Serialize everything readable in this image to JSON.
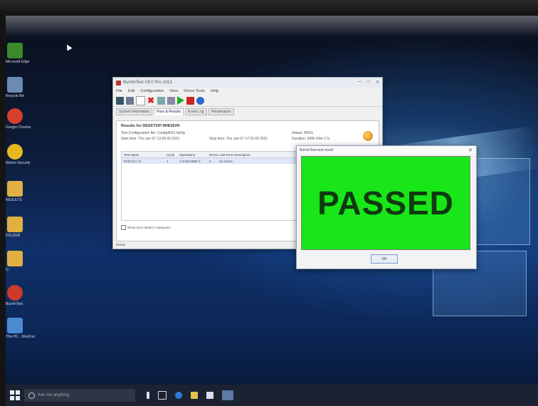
{
  "desktop": {
    "icons": [
      {
        "label": "Microsoft Edge",
        "color": "#3a8a2a"
      },
      {
        "label": "Recycle Bin",
        "color": "#6b8bb0"
      },
      {
        "label": "Google Chrome",
        "color": "#d8402a"
      },
      {
        "label": "Norton Security",
        "color": "#e8b820"
      },
      {
        "label": "RESULTS",
        "color": "#e0b040"
      },
      {
        "label": "FOLDER",
        "color": "#e0b040"
      },
      {
        "label": "C:",
        "color": "#e0b040"
      },
      {
        "label": "BurnInTest",
        "color": "#cc3a2a"
      },
      {
        "label": "This PC - Shortcut",
        "color": "#4a8ad0"
      }
    ]
  },
  "main_window": {
    "title": "BurnInTest V9.0 Pro 1013",
    "menu": [
      "File",
      "Edit",
      "Configuration",
      "View",
      "Stress Tests",
      "Help"
    ],
    "toolbar_icons": [
      {
        "name": "save-icon",
        "color": "#356"
      },
      {
        "name": "config-icon",
        "color": "#6a7a90"
      },
      {
        "name": "clear-icon",
        "color": "#999"
      },
      {
        "name": "delete-icon",
        "color": "#d22"
      },
      {
        "name": "copy-icon",
        "color": "#7aa"
      },
      {
        "name": "window-icon",
        "color": "#88a"
      },
      {
        "name": "play-icon",
        "color": "#2a2"
      },
      {
        "name": "stop-icon",
        "color": "#c22"
      },
      {
        "name": "help-icon",
        "color": "#36c"
      }
    ],
    "tabs": [
      {
        "label": "System Information",
        "active": false
      },
      {
        "label": "Pass & Results",
        "active": true
      },
      {
        "label": "Event Log",
        "active": false
      },
      {
        "label": "Temperature",
        "active": false
      }
    ],
    "results_heading": "Results for DESKTOP-9HE55VK",
    "config_file": "Test Configuration file: Config4h01.bitcfg",
    "start_time": "Start time:     Thu Jan 07 13:30:43 2021",
    "stop_time": "Stop time:   Thu Jan 07 17:31:00 2021",
    "status": "Status:    PASS",
    "duration": "Duration:  000h 04m 17s",
    "table": {
      "headers": [
        "Test Name",
        "Cycle",
        "Operations",
        "Errors",
        "Last Error Description"
      ],
      "rows": [
        [
          "RAM (C1 C)",
          "1",
          "4 0,510 BBB C",
          "0",
          "No errors"
        ]
      ]
    },
    "checkbox_label": "Show error detail in categories",
    "statusbar": "Ready"
  },
  "result_dialog": {
    "title": "BurnInTest test result",
    "result": "PASSED",
    "result_color": "#19e619",
    "ok_label": "OK"
  },
  "taskbar": {
    "search_placeholder": "Ask me anything",
    "apps": [
      {
        "name": "microphone-icon",
        "color": "#dde"
      },
      {
        "name": "task-view-icon",
        "color": "#dde"
      },
      {
        "name": "edge-icon",
        "color": "#2a7ad8"
      },
      {
        "name": "file-explorer-icon",
        "color": "#e8c250"
      },
      {
        "name": "store-icon",
        "color": "#dde"
      },
      {
        "name": "burnintest-taskbar-icon",
        "color": "#5a78a8"
      }
    ]
  }
}
